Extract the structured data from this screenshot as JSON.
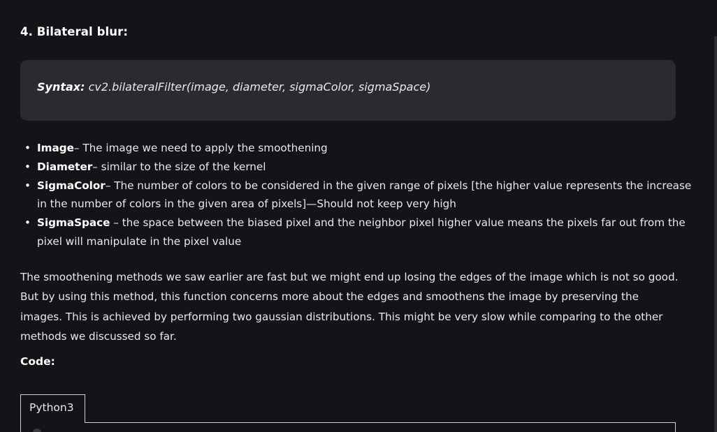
{
  "article": {
    "heading": "4. Bilateral blur:",
    "syntax": {
      "label": "Syntax:",
      "signature": " cv2.bilateralFilter(image, diameter, sigmaColor, sigmaSpace)"
    },
    "params": [
      {
        "name": "Image",
        "desc": "– The image we need to apply the smoothening"
      },
      {
        "name": "Diameter",
        "desc": "– similar to the size of the kernel"
      },
      {
        "name": "SigmaColor",
        "desc": "– The number of colors to be considered in the given range of pixels [the higher value represents the increase in the number of colors in the given area of pixels]—Should not keep very high"
      },
      {
        "name": "SigmaSpace",
        "desc": " – the space between the biased pixel and the neighbor pixel higher value means the pixels far out from the pixel will manipulate in the pixel value"
      }
    ],
    "body": "The smoothening methods we saw earlier are fast but we might end up losing the edges of the image which is not so good. But by using this method, this function concerns more about the edges and smoothens the image by preserving the images. This is achieved by performing two gaussian distributions. This might be very slow while comparing to the other methods we discussed so far.",
    "code_label": "Code:",
    "code_tab": "Python3"
  },
  "theme": {
    "background": "#131417",
    "syntax_box": "#2a2b2f",
    "text": "#e8e9ec",
    "tab_border": "#d0d0d0"
  }
}
